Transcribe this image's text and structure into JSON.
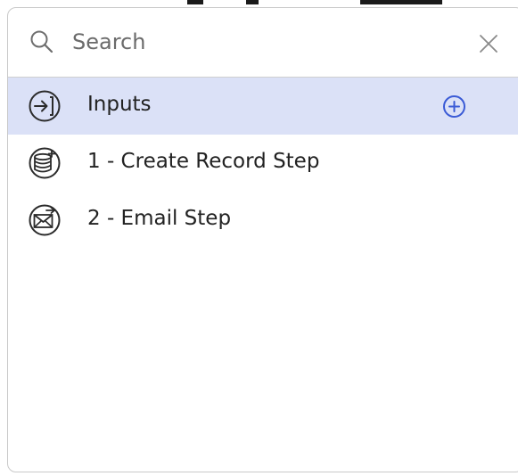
{
  "search": {
    "placeholder": "Search",
    "value": ""
  },
  "items": [
    {
      "label": "Inputs",
      "icon": "arrow-into-bracket-icon",
      "selected": true
    },
    {
      "label": "1 - Create Record Step",
      "icon": "database-add-icon",
      "selected": false
    },
    {
      "label": "2 - Email Step",
      "icon": "email-send-icon",
      "selected": false
    }
  ],
  "colors": {
    "selected_row": "#dbe1f7",
    "accent": "#3b5bd6",
    "border": "#c9c9c9",
    "text": "#222222"
  }
}
